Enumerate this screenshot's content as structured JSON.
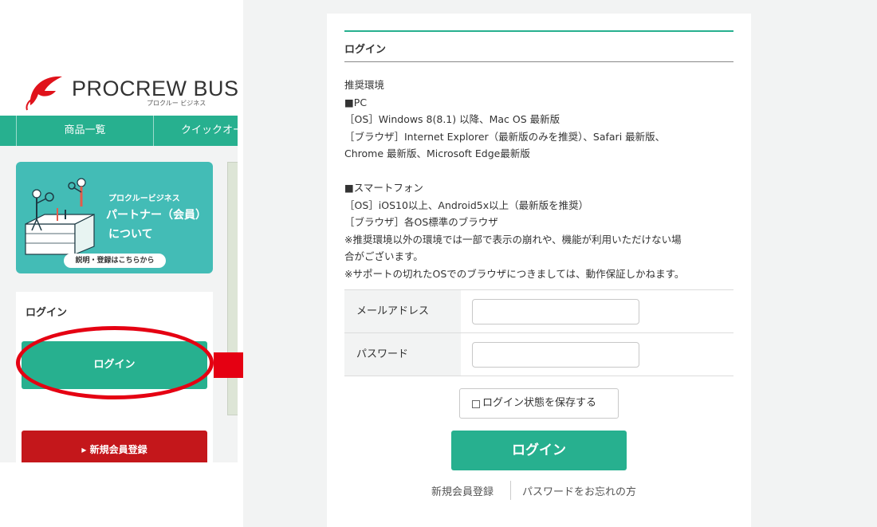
{
  "left": {
    "logo": {
      "name": "PROCREW BUSIN",
      "sub": "プロクルー ビジネス"
    },
    "nav": {
      "products": "商品一覧",
      "quick": "クイックオー"
    },
    "partner_banner": {
      "brand": "プロクルービジネス",
      "title_line1": "パートナー（会員）",
      "title_line2": "について",
      "cta": "説明・登録はこちらから"
    },
    "login_panel": {
      "title": "ログイン",
      "login_button": "ログイン",
      "register_button": "▸ 新規会員登録"
    }
  },
  "login_page": {
    "title": "ログイン",
    "environment": {
      "heading": "推奨環境",
      "pc_heading": "■PC",
      "pc_os": "［OS］Windows 8(8.1) 以降、Mac OS 最新版",
      "pc_browser_1": "［ブラウザ］Internet Explorer（最新版のみを推奨）、Safari 最新版、",
      "pc_browser_2": "Chrome 最新版、Microsoft Edge最新版",
      "sp_heading": "■スマートフォン",
      "sp_os": "［OS］iOS10以上、Android5x以上（最新版を推奨）",
      "sp_browser": "［ブラウザ］各OS標準のブラウザ",
      "note_1a": "※推奨環境以外の環境では一部で表示の崩れや、機能が利用いただけない場",
      "note_1b": "合がございます。",
      "note_2": "※サポートの切れたOSでのブラウザにつきましては、動作保証しかねます。"
    },
    "form": {
      "email_label": "メールアドレス",
      "email_value": "",
      "password_label": "パスワード",
      "password_value": ""
    },
    "remember_label": "ログイン状態を保存する",
    "login_button": "ログイン",
    "links": {
      "register": "新規会員登録",
      "forgot_password": "パスワードをお忘れの方"
    }
  },
  "colors": {
    "accent_green": "#27b08f",
    "banner_teal": "#43bcb6",
    "register_red": "#c4171b",
    "highlight_red": "#e50012"
  }
}
